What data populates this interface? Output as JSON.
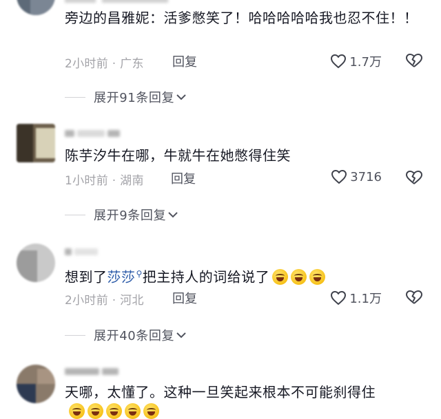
{
  "comments": [
    {
      "text": "旁边的昌雅妮：活爹憋笑了！哈哈哈哈哈我也忍不住！！",
      "time": "2小时前",
      "location": "广东",
      "reply_label": "回复",
      "likes": "1.7万",
      "expand_label": "展开91条回复"
    },
    {
      "text": "陈芋汐牛在哪，牛就牛在她憋得住笑",
      "time": "1小时前",
      "location": "湖南",
      "reply_label": "回复",
      "likes": "3716",
      "expand_label": "展开9条回复"
    },
    {
      "text_before": "想到了",
      "mention": "莎莎",
      "text_after": "把主持人的词给说了",
      "emoji": [
        "laughing-tears-emoji",
        "laughing-tears-emoji",
        "laughing-tears-emoji"
      ],
      "time": "2小时前",
      "location": "河北",
      "reply_label": "回复",
      "likes": "1.1万",
      "expand_label": "展开40条回复"
    },
    {
      "text": "天哪，太懂了。这种一旦笑起来根本不可能刹得住"
    }
  ],
  "meta_separator": " · ",
  "icons": {
    "like": "heart-outline-icon",
    "dislike": "broken-heart-icon",
    "expand": "chevron-down-icon",
    "mention": "search-icon"
  },
  "colors": {
    "text": "#161823",
    "meta": "#a3a3a8",
    "action": "#50535e",
    "mention": "#2b5aa8"
  }
}
